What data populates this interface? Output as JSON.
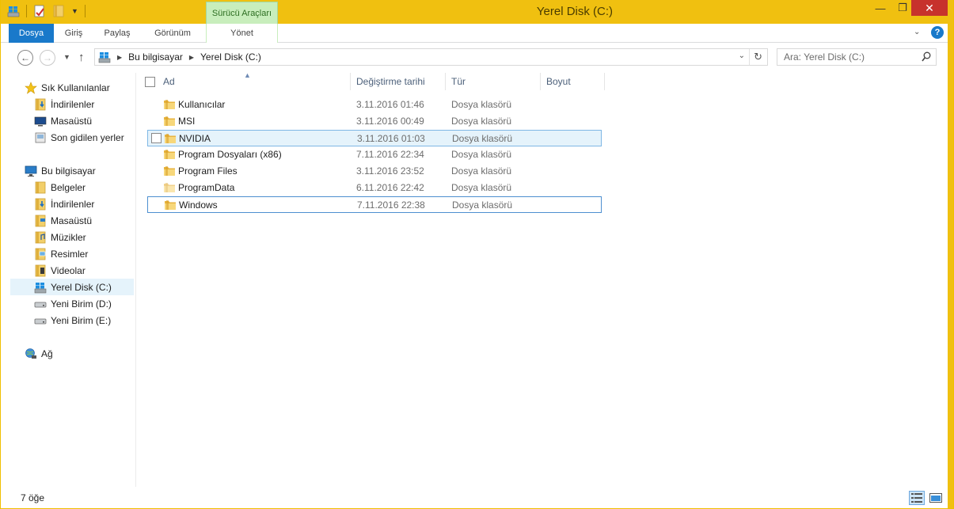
{
  "window": {
    "title": "Yerel Disk (C:)",
    "context_tab_header": "Sürücü Araçları"
  },
  "ribbon": {
    "tabs": [
      "Dosya",
      "Giriş",
      "Paylaş",
      "Görünüm",
      "Yönet"
    ]
  },
  "address": {
    "crumbs": [
      "Bu bilgisayar",
      "Yerel Disk (C:)"
    ],
    "search_placeholder": "Ara: Yerel Disk (C:)"
  },
  "nav_pane": {
    "favorites_label": "Sık Kullanılanlar",
    "favorites": [
      "İndirilenler",
      "Masaüstü",
      "Son gidilen yerler"
    ],
    "this_pc_label": "Bu bilgisayar",
    "this_pc": [
      "Belgeler",
      "İndirilenler",
      "Masaüstü",
      "Müzikler",
      "Resimler",
      "Videolar",
      "Yerel Disk (C:)",
      "Yeni Birim (D:)",
      "Yeni Birim (E:)"
    ],
    "network_label": "Ağ"
  },
  "columns": [
    "Ad",
    "Değiştirme tarihi",
    "Tür",
    "Boyut"
  ],
  "files": [
    {
      "name": "Kullanıcılar",
      "date": "3.11.2016 01:46",
      "type": "Dosya klasörü"
    },
    {
      "name": "MSI",
      "date": "3.11.2016 00:49",
      "type": "Dosya klasörü"
    },
    {
      "name": "NVIDIA",
      "date": "3.11.2016 01:03",
      "type": "Dosya klasörü"
    },
    {
      "name": "Program Dosyaları (x86)",
      "date": "7.11.2016 22:34",
      "type": "Dosya klasörü"
    },
    {
      "name": "Program Files",
      "date": "3.11.2016 23:52",
      "type": "Dosya klasörü"
    },
    {
      "name": "ProgramData",
      "date": "6.11.2016 22:42",
      "type": "Dosya klasörü"
    },
    {
      "name": "Windows",
      "date": "7.11.2016 22:38",
      "type": "Dosya klasörü"
    }
  ],
  "status": {
    "item_count": "7 öğe"
  },
  "colors": {
    "title_bar": "#f0c010",
    "file_tab": "#1979ca",
    "context_tab": "#c8eebc",
    "close_button": "#c7322c",
    "selection": "#e5f3fb"
  }
}
